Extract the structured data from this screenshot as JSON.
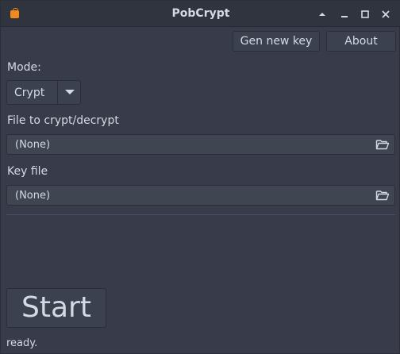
{
  "window": {
    "title": "PobCrypt"
  },
  "titlebar": {
    "icons": [
      "app-icon",
      "shade-icon",
      "minimize-icon",
      "maximize-icon",
      "close-icon"
    ]
  },
  "toolbar": {
    "gen_key_label": "Gen new key",
    "about_label": "About"
  },
  "mode": {
    "label": "Mode:",
    "selected": "Crypt"
  },
  "file": {
    "label": "File to crypt/decrypt",
    "value": "(None)"
  },
  "key": {
    "label": "Key file",
    "value": "(None)"
  },
  "action": {
    "start_label": "Start"
  },
  "status": {
    "text": "ready."
  },
  "colors": {
    "window_bg": "#383c4a",
    "titlebar_bg": "#2f343f",
    "button_bg": "#3c4150",
    "field_bg": "#404552",
    "text": "#d3dae3",
    "accent": "#f08a1c"
  }
}
